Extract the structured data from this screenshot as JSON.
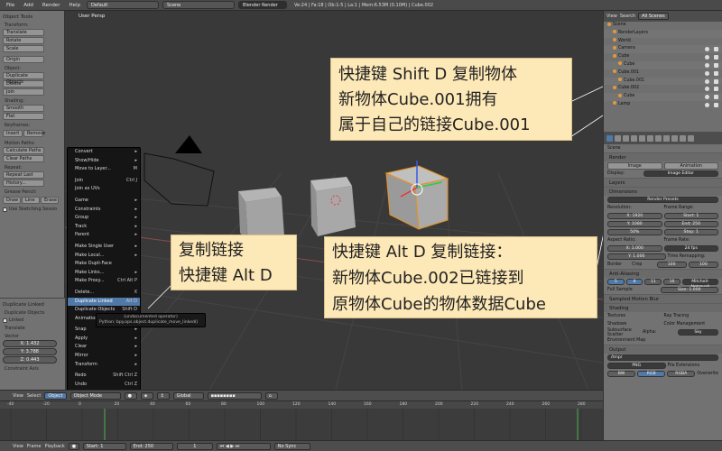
{
  "topbar": {
    "menus": [
      "File",
      "Add",
      "Render",
      "Help"
    ],
    "layout": "Default",
    "scene": "Scene",
    "engine": "Blender Render",
    "stats": "Ve:24 | Fa:18 | Ob:1-5 | La:1 | Mem:6.53M (0.10M) | Cube.002"
  },
  "toolshelf": {
    "title": "Object Tools",
    "transform_label": "Transform:",
    "transform_buttons": [
      "Translate",
      "Rotate",
      "Scale"
    ],
    "origin_button": "Origin",
    "object_label": "Object:",
    "object_buttons": [
      "Duplicate Objects",
      "Delete",
      "Join"
    ],
    "shading_label": "Shading:",
    "shading_buttons": [
      "Smooth",
      "Flat"
    ],
    "keyframes_label": "Keyframes:",
    "keyframes_buttons": [
      "Insert",
      "Remove"
    ],
    "motion_label": "Motion Paths:",
    "motion_buttons": [
      "Calculate Paths",
      "Clear Paths"
    ],
    "repeat_label": "Repeat:",
    "repeat_buttons": [
      "Repeat Last",
      "History..."
    ],
    "grease_label": "Grease Pencil:",
    "grease_buttons": [
      "Draw",
      "Line",
      "Erase"
    ],
    "sketch_check": "Use Sketching Sessio"
  },
  "operator": {
    "title": "Duplicate Linked",
    "dup_label": "Duplicate Objects",
    "linked": "Linked",
    "translate_label": "Translate",
    "vector_label": "Vector",
    "vx": "X: 1.432",
    "vy": "Y: 3.788",
    "vz": "Z: 0.443",
    "constraint": "Constraint Axis"
  },
  "viewport": {
    "label": "User Persp"
  },
  "context_menu": {
    "items": [
      {
        "label": "Convert",
        "shortcut": "▸"
      },
      {
        "label": "Show/Hide",
        "shortcut": "▸"
      },
      {
        "label": "Move to Layer...",
        "shortcut": "M"
      },
      {
        "label": "Join",
        "shortcut": "Ctrl J"
      },
      {
        "label": "Join as UVs",
        "shortcut": ""
      },
      {
        "label": "Game",
        "shortcut": "▸"
      },
      {
        "label": "Constraints",
        "shortcut": "▸"
      },
      {
        "label": "Group",
        "shortcut": "▸"
      },
      {
        "label": "Track",
        "shortcut": "▸"
      },
      {
        "label": "Parent",
        "shortcut": "▸"
      },
      {
        "label": "Make Single User",
        "shortcut": "▸"
      },
      {
        "label": "Make Local...",
        "shortcut": "▸"
      },
      {
        "label": "Make Dupli-Face",
        "shortcut": ""
      },
      {
        "label": "Make Links...",
        "shortcut": "▸"
      },
      {
        "label": "Make Proxy...",
        "shortcut": "Ctrl Alt P"
      },
      {
        "label": "Delete...",
        "shortcut": "X"
      },
      {
        "label": "Duplicate Linked",
        "shortcut": "Alt D"
      },
      {
        "label": "Duplicate Objects",
        "shortcut": "Shift D"
      },
      {
        "label": "Animation",
        "shortcut": ""
      },
      {
        "label": "Snap",
        "shortcut": "▸"
      },
      {
        "label": "Apply",
        "shortcut": "▸"
      },
      {
        "label": "Clear",
        "shortcut": "▸"
      },
      {
        "label": "Mirror",
        "shortcut": "▸"
      },
      {
        "label": "Transform",
        "shortcut": "▸"
      },
      {
        "label": "Redo",
        "shortcut": "Shift Ctrl Z"
      },
      {
        "label": "Undo",
        "shortcut": "Ctrl Z"
      }
    ],
    "tooltip_line1": "(undocumented operator)",
    "tooltip_line2": "Python: bpy.ops.object.duplicate_move_linked()"
  },
  "annotations": {
    "top": [
      "快捷键 Shift D 复制物体",
      "新物体Cube.001拥有",
      "属于自己的链接Cube.001"
    ],
    "left": [
      "复制链接",
      "快捷键 Alt D"
    ],
    "right": [
      "快捷键 Alt D 复制链接：",
      "新物体Cube.002已链接到",
      "原物体Cube的物体数据Cube"
    ]
  },
  "view3d_header": {
    "menus": [
      "View",
      "Select",
      "Object"
    ],
    "mode": "Object Mode",
    "pivot": "Global"
  },
  "timeline": {
    "ticks": [
      "-40",
      "-20",
      "0",
      "20",
      "40",
      "60",
      "80",
      "100",
      "120",
      "140",
      "160",
      "180",
      "200",
      "220",
      "240",
      "260",
      "280"
    ],
    "menus": [
      "View",
      "Frame",
      "Playback"
    ],
    "start": "Start: 1",
    "end": "End: 250",
    "current": "1",
    "sync": "No Sync"
  },
  "outliner": {
    "view": "View",
    "search": "Search",
    "filter": "All Scenes",
    "rows": [
      "Scene",
      "RenderLayers",
      "World",
      "Camera",
      "Cube",
      "Cube",
      "Cube.001",
      "Cube.001",
      "Cube.002",
      "Cube",
      "Lamp"
    ]
  },
  "properties": {
    "scene_name": "Scene",
    "render_hdr": "Render",
    "image_btn": "Image",
    "anim_btn": "Animation",
    "display_label": "Display:",
    "display_val": "Image Editor",
    "layers_hdr": "Layers",
    "dims_hdr": "Dimensions",
    "presets": "Render Presets",
    "resolution_label": "Resolution:",
    "frame_range_label": "Frame Range:",
    "res_x": "X: 1920",
    "res_y": "Y: 1080",
    "res_pct": "50%",
    "start": "Start: 1",
    "end": "End: 250",
    "step": "Step: 1",
    "aspect_label": "Aspect Ratio:",
    "frame_rate_label": "Frame Rate:",
    "asp_x": "X: 1.000",
    "asp_y": "Y: 1.000",
    "fps": "24 fps",
    "time_remap": "Time Remapping:",
    "old": "100",
    "new": "100",
    "border": "Border",
    "crop": "Crop",
    "aa_hdr": "Anti-Aliasing",
    "aa_vals": [
      "5",
      "8",
      "11",
      "16"
    ],
    "aa_filter": "Mitchell-Netravali",
    "full_sample": "Full Sample",
    "aa_size": "Size: 1.000",
    "mblur_hdr": "Sampled Motion Blur",
    "shading_hdr": "Shading",
    "textures": "Textures",
    "raytracing": "Ray Tracing",
    "shadows": "Shadows",
    "color_mgmt": "Color Management",
    "sss": "Subsurface Scatter",
    "alpha_label": "Alpha:",
    "alpha_val": "Sky",
    "env_map": "Environment Map",
    "output_hdr": "Output",
    "output_path": "/tmp/",
    "format": "PNG",
    "file_ext": "File Extensions",
    "bw": "BW",
    "rgb": "RGB",
    "rgba": "RGBA",
    "overwrite": "Overwrite"
  }
}
